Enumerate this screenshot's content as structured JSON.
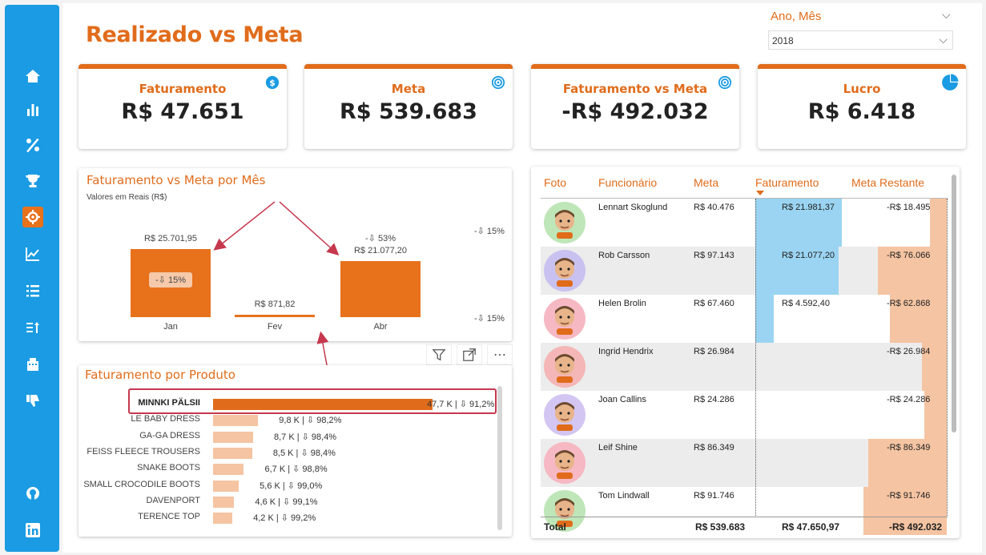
{
  "page": {
    "title": "Realizado vs Meta",
    "slicer": {
      "title": "Ano, Mês",
      "value": "2018"
    }
  },
  "nav": [
    {
      "name": "home-icon"
    },
    {
      "name": "bar-chart-icon"
    },
    {
      "name": "percent-icon"
    },
    {
      "name": "trophy-icon"
    },
    {
      "name": "target-icon",
      "active": true
    },
    {
      "name": "line-chart-icon"
    },
    {
      "name": "list-icon"
    },
    {
      "name": "sort-icon"
    },
    {
      "name": "building-icon"
    },
    {
      "name": "thumbs-down-icon"
    },
    {
      "name": "github-icon"
    },
    {
      "name": "linkedin-icon"
    }
  ],
  "kpis": [
    {
      "label": "Faturamento",
      "value": "R$ 47.651",
      "icon": "dollar-icon"
    },
    {
      "label": "Meta",
      "value": "R$ 539.683",
      "icon": "target-icon"
    },
    {
      "label": "Faturamento vs Meta",
      "value": "-R$ 492.032",
      "icon": "target-icon"
    },
    {
      "label": "Lucro",
      "value": "R$ 6.418",
      "icon": "pie-icon"
    }
  ],
  "monthly": {
    "title": "Faturamento vs Meta por Mês",
    "subtitle": "Valores em Reais (R$)",
    "side_pct_top": "-⇩ 15%",
    "side_pct_bottom": "-⇩ 15%"
  },
  "products": {
    "title": "Faturamento por Produto"
  },
  "chart_data": [
    {
      "type": "bar",
      "title": "Faturamento vs Meta por Mês",
      "categories": [
        "Jan",
        "Fev",
        "Abr"
      ],
      "values": [
        25701.95,
        871.82,
        21077.2
      ],
      "value_labels": [
        "R$ 25.701,95",
        "R$ 871,82",
        "R$ 21.077,20"
      ],
      "badges": [
        "-⇩ 15%",
        "",
        "-⇩ 53%"
      ],
      "ylim": [
        0,
        25701.95
      ]
    },
    {
      "type": "bar",
      "title": "Faturamento por Produto",
      "categories": [
        "MINNKI PÄLSII",
        "LE BABY DRESS",
        "GA-GA DRESS",
        "FEISS FLEECE TROUSERS",
        "SNAKE BOOTS",
        "SMALL CROCODILE BOOTS",
        "DAVENPORT",
        "TERENCE TOP"
      ],
      "values": [
        47.7,
        9.8,
        8.7,
        8.5,
        6.7,
        5.6,
        4.6,
        4.2
      ],
      "value_labels": [
        "47,7 K | ⇩ 91,2%",
        "9,8 K | ⇩ 98,2%",
        "8,7 K | ⇩ 98,4%",
        "8,5 K | ⇩ 98,4%",
        "6,7 K | ⇩ 98,8%",
        "5,6 K | ⇩ 99,0%",
        "4,6 K | ⇩ 99,1%",
        "4,2 K | ⇩ 99,2%"
      ],
      "xlim": [
        0,
        47.7
      ]
    },
    {
      "type": "table",
      "columns": [
        "Foto",
        "Funcionário",
        "Meta",
        "Faturamento",
        "Meta Restante"
      ],
      "rows": [
        {
          "name": "Lennart Skoglund",
          "meta": "R$ 40.476",
          "meta_v": 40476,
          "fat": "R$ 21.981,37",
          "fat_v": 21981.37,
          "rest": "-R$ 18.495",
          "rest_v": 18495,
          "color": "#bfe6b8"
        },
        {
          "name": "Rob Carsson",
          "meta": "R$ 97.143",
          "meta_v": 97143,
          "fat": "R$ 21.077,20",
          "fat_v": 21077.2,
          "rest": "-R$ 76.066",
          "rest_v": 76066,
          "color": "#c9c2f0"
        },
        {
          "name": "Helen Brolin",
          "meta": "R$ 67.460",
          "meta_v": 67460,
          "fat": "R$ 4.592,40",
          "fat_v": 4592.4,
          "rest": "-R$ 62.868",
          "rest_v": 62868,
          "color": "#f6b8c3"
        },
        {
          "name": "Ingrid Hendrix",
          "meta": "R$ 26.984",
          "meta_v": 26984,
          "fat": "",
          "fat_v": 0,
          "rest": "-R$ 26.984",
          "rest_v": 26984,
          "color": "#f4b6b6"
        },
        {
          "name": "Joan Callins",
          "meta": "R$ 24.286",
          "meta_v": 24286,
          "fat": "",
          "fat_v": 0,
          "rest": "-R$ 24.286",
          "rest_v": 24286,
          "color": "#d4c6f2"
        },
        {
          "name": "Leif Shine",
          "meta": "R$ 86.349",
          "meta_v": 86349,
          "fat": "",
          "fat_v": 0,
          "rest": "-R$ 86.349",
          "rest_v": 86349,
          "color": "#f6b8c3"
        },
        {
          "name": "Tom Lindwall",
          "meta": "R$ 91.746",
          "meta_v": 91746,
          "fat": "",
          "fat_v": 0,
          "rest": "-R$ 91.746",
          "rest_v": 91746,
          "color": "#bfe6b8"
        }
      ],
      "total": {
        "label": "Total",
        "meta": "R$ 539.683",
        "fat": "R$ 47.650,97",
        "rest": "-R$ 492.032"
      }
    }
  ]
}
